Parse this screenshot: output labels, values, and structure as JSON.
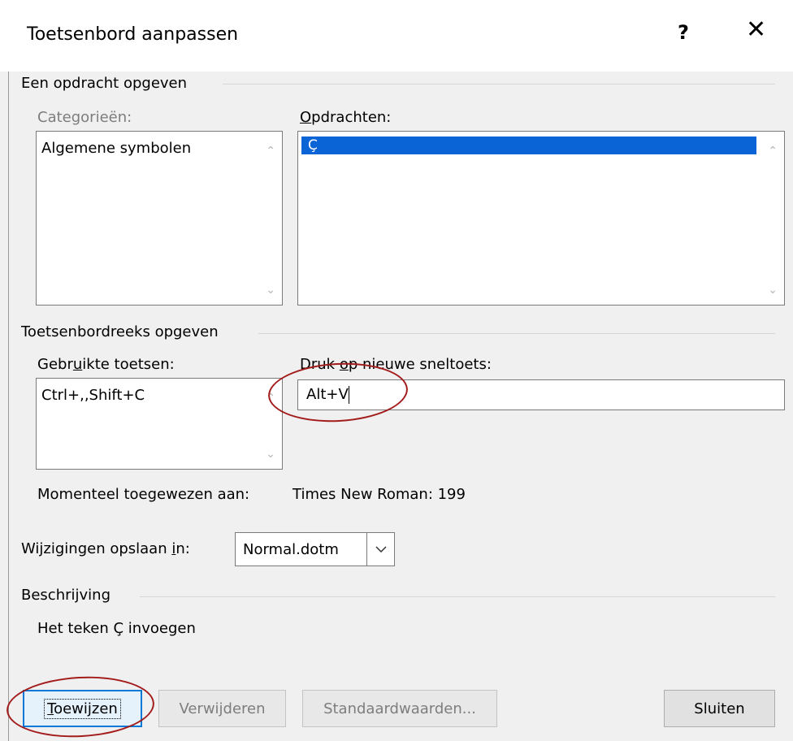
{
  "dialog": {
    "title": "Toetsenbord aanpassen",
    "help_label": "?",
    "close_label": "✕"
  },
  "command_group": {
    "title": "Een opdracht opgeven",
    "categories_label": "Categorieën:",
    "categories_items": [
      "Algemene symbolen"
    ],
    "commands_label_prefix": "",
    "commands_label_u": "O",
    "commands_label_rest": "pdrachten:",
    "commands_items": [
      "Ç"
    ]
  },
  "keyboard_group": {
    "title": "Toetsenbordreeks opgeven",
    "used_keys_label_pre": "Gebr",
    "used_keys_label_u": "u",
    "used_keys_label_post": "ikte toetsen:",
    "used_keys_items": [
      "Ctrl+,,Shift+C"
    ],
    "new_key_label_pre": "Druk ",
    "new_key_label_u": "o",
    "new_key_label_post": "p nieuwe sneltoets:",
    "new_key_value": "Alt+V"
  },
  "assigned": {
    "label": "Momenteel toegewezen aan:",
    "value": "Times New Roman: 199"
  },
  "save_in": {
    "label_pre": "Wijzigingen opslaan ",
    "label_u": "i",
    "label_post": "n:",
    "selected": "Normal.dotm"
  },
  "description": {
    "title": "Beschrijving",
    "text": "Het teken Ç invoegen"
  },
  "buttons": {
    "assign_u": "T",
    "assign_rest": "oewijzen",
    "remove": "Verwijderen",
    "defaults": "Standaardwaarden...",
    "close": "Sluiten"
  }
}
